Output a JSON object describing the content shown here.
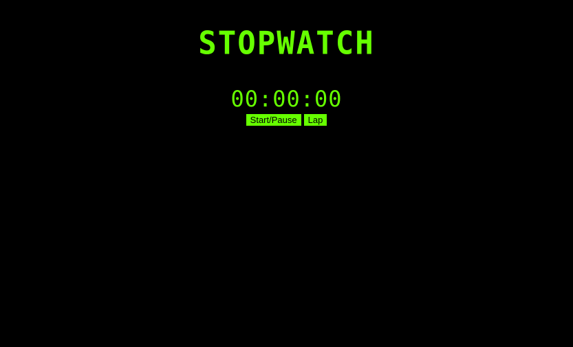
{
  "app": {
    "title": "STOPWATCH",
    "display": "00:00:00"
  },
  "controls": {
    "start_pause_label": "Start/Pause",
    "lap_label": "Lap"
  },
  "colors": {
    "background": "#000000",
    "accent": "#66ff00",
    "button_text": "#000000"
  }
}
